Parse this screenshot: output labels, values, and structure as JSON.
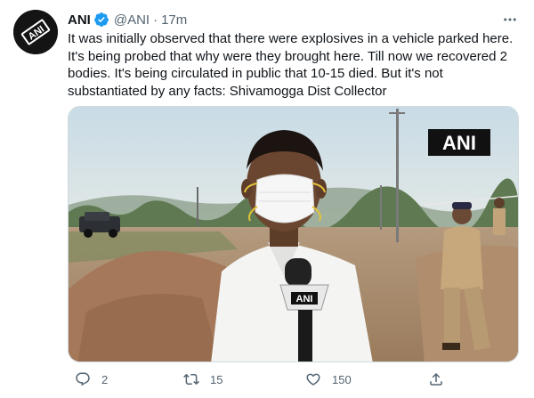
{
  "tweet": {
    "author_name": "ANI",
    "handle": "@ANI",
    "separator": "·",
    "time": "17m",
    "text": "It was initially observed that there were explosives in a vehicle parked here.\nIt's being probed that why were they brought here. Till now we recovered 2\nbodies. It's being circulated in public that 10-15 died. But it's not\nsubstantiated by any facts: Shivamogga Dist Collector",
    "avatar_text": "ANI",
    "watermark": "ANI",
    "mic_label": "ANI"
  },
  "actions": {
    "reply_count": "2",
    "retweet_count": "15",
    "like_count": "150"
  },
  "colors": {
    "verified": "#1d9bf0",
    "muted": "#536471",
    "text": "#0f1419"
  }
}
